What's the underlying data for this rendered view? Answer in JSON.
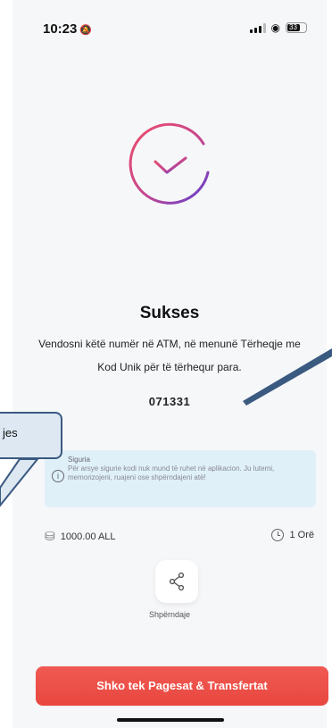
{
  "status_bar": {
    "time": "10:23",
    "battery": "33"
  },
  "main": {
    "title": "Sukses",
    "description": "Vendosni këtë numër në ATM, në menunë Tërheqje me Kod Unik për të tërhequr para.",
    "code": "071331"
  },
  "info": {
    "title": "Siguria",
    "text": "Për arsye sigurie kodi nuk mund të ruhet në aplikacion. Ju lutemi, memorizojeni, ruajeni ose shpërndajeni atë!"
  },
  "details": {
    "amount": "1000.00 ALL",
    "duration": "1 Orë"
  },
  "share": {
    "label": "Shpërndaje"
  },
  "cta": {
    "label": "Shko tek Pagesat & Transfertat"
  },
  "annotation": {
    "callout_text": "jes"
  },
  "colors": {
    "accent": "#e8473f",
    "check_gradient_start": "#e8456b",
    "check_gradient_end": "#5b3fd1",
    "info_bg": "#dff0f8",
    "annotation_stroke": "#3a5a80"
  },
  "icons": [
    "bell-icon",
    "signal-icon",
    "wifi-icon",
    "battery-icon",
    "success-check-icon",
    "info-icon",
    "coins-icon",
    "clock-icon",
    "share-icon"
  ]
}
